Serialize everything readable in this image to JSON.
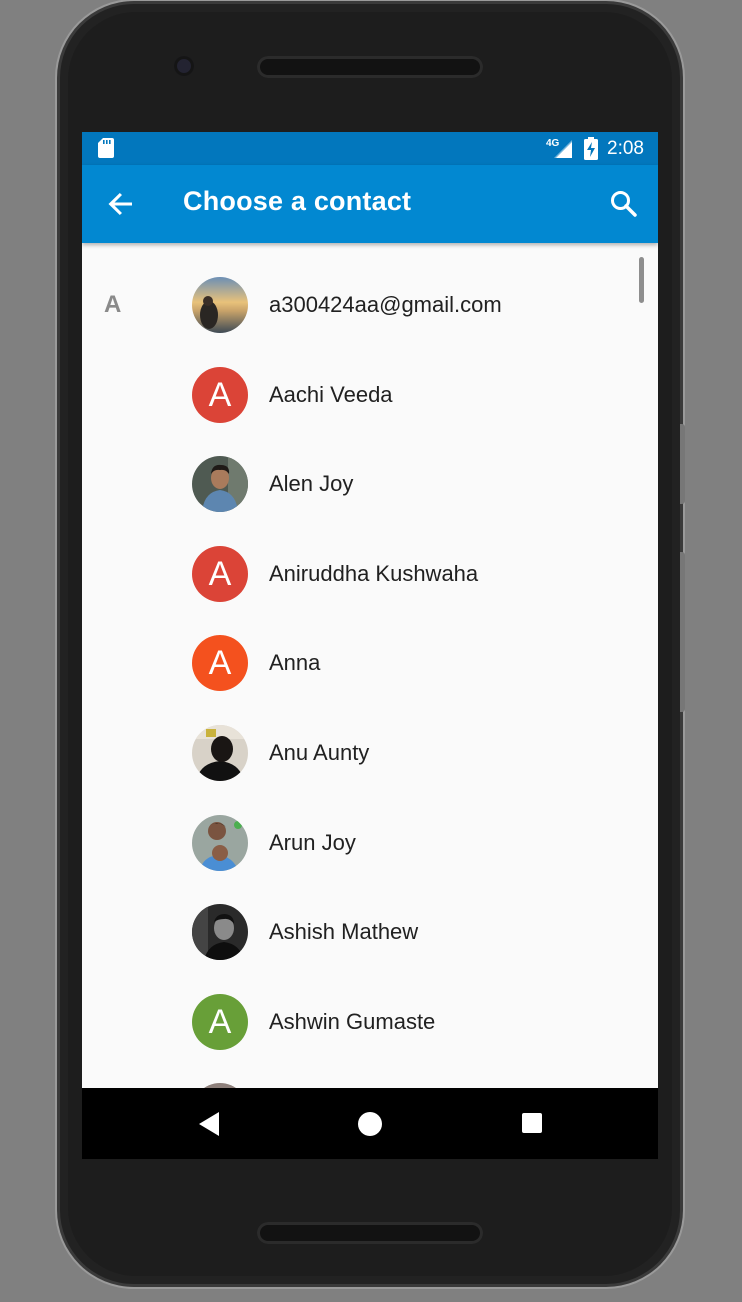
{
  "status_bar": {
    "network_label": "4G",
    "time": "2:08",
    "icons": [
      "sd-card-icon",
      "signal-icon",
      "battery-charging-icon"
    ]
  },
  "app_bar": {
    "title": "Choose a contact",
    "back_icon": "arrow-back-icon",
    "search_icon": "search-icon",
    "color": "#0288d1",
    "status_color": "#0277bd"
  },
  "section": {
    "letter": "A"
  },
  "contacts": [
    {
      "name": "a300424aa@gmail.com",
      "avatar": "photo"
    },
    {
      "name": "Aachi Veeda",
      "avatar": "letter",
      "letter": "A",
      "color": "#db4437"
    },
    {
      "name": "Alen Joy",
      "avatar": "photo"
    },
    {
      "name": "Aniruddha Kushwaha",
      "avatar": "letter",
      "letter": "A",
      "color": "#db4437"
    },
    {
      "name": "Anna",
      "avatar": "letter",
      "letter": "A",
      "color": "#f4511e"
    },
    {
      "name": "Anu Aunty",
      "avatar": "photo"
    },
    {
      "name": "Arun Joy",
      "avatar": "photo"
    },
    {
      "name": "Ashish Mathew",
      "avatar": "photo"
    },
    {
      "name": "Ashwin Gumaste",
      "avatar": "letter",
      "letter": "A",
      "color": "#689f38"
    }
  ],
  "nav_bar": {
    "icons": [
      "nav-back-icon",
      "nav-home-icon",
      "nav-recents-icon"
    ]
  }
}
